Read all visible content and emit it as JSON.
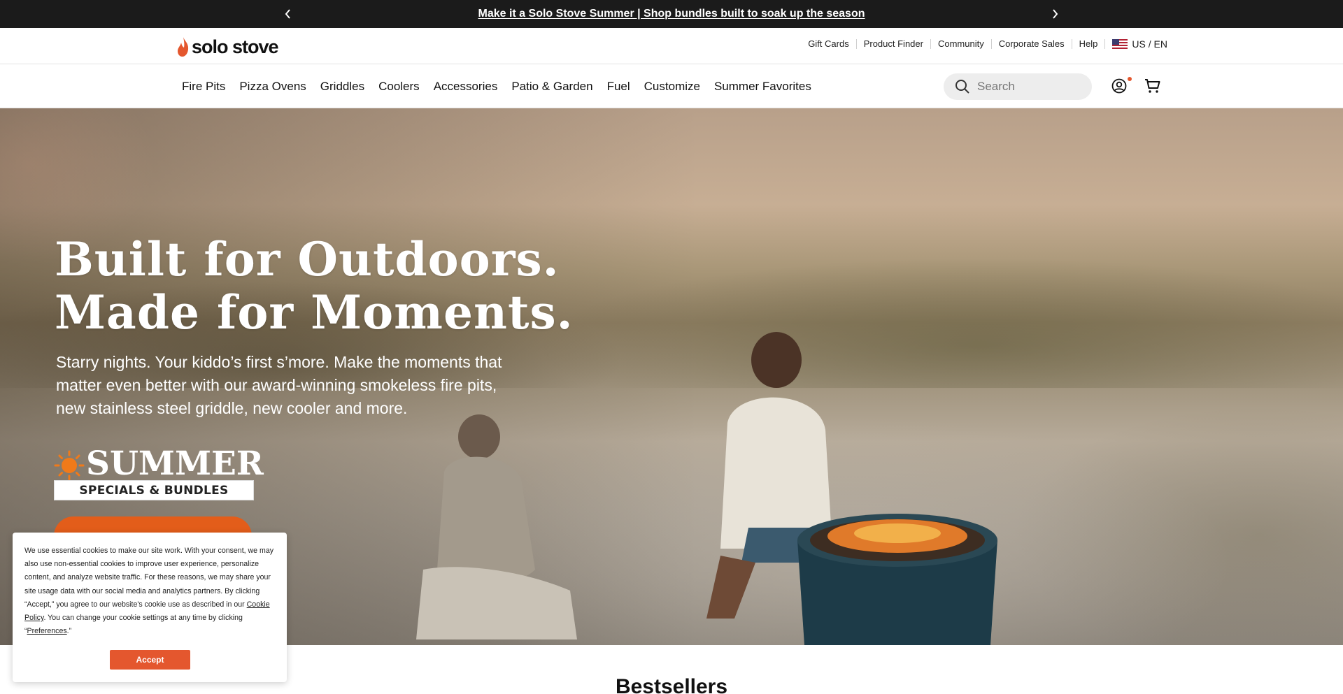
{
  "announcement": {
    "message": "Make it a Solo Stove Summer | Shop bundles built to soak up the season"
  },
  "header": {
    "logo_text": "solo stove",
    "utility_links": [
      "Gift Cards",
      "Product Finder",
      "Community",
      "Corporate Sales",
      "Help"
    ],
    "locale": "US / EN"
  },
  "nav": {
    "items": [
      "Fire Pits",
      "Pizza Ovens",
      "Griddles",
      "Coolers",
      "Accessories",
      "Patio & Garden",
      "Fuel",
      "Customize",
      "Summer Favorites"
    ],
    "search_placeholder": "Search"
  },
  "hero": {
    "headline_line1": "Built for Outdoors.",
    "headline_line2": "Made for Moments.",
    "subtext": "Starry nights. Your kiddo’s first s’more. Make the moments that matter even better with our award-winning smokeless fire pits, new stainless steel griddle, new cooler and more.",
    "badge_word": "SUMMER",
    "badge_band": "SPECIALS & BUNDLES"
  },
  "cookie": {
    "text_1": "We use essential cookies to make our site work. With your consent, we may also use non-essential cookies to improve user experience, personalize content, and analyze website traffic. For these reasons, we may share your site usage data with our social media and analytics partners. By clicking “Accept,” you agree to our website's cookie use as described in our ",
    "cookie_policy_link": "Cookie Policy",
    "text_2": ". You can change your cookie settings at any time by clicking “",
    "preferences_link": "Preferences",
    "text_3": ".”",
    "accept_label": "Accept"
  },
  "section": {
    "bestsellers_title": "Bestsellers"
  },
  "colors": {
    "accent": "#e4572e",
    "announcement_bg": "#1b1b1b",
    "cta_orange": "#e35d1a"
  }
}
